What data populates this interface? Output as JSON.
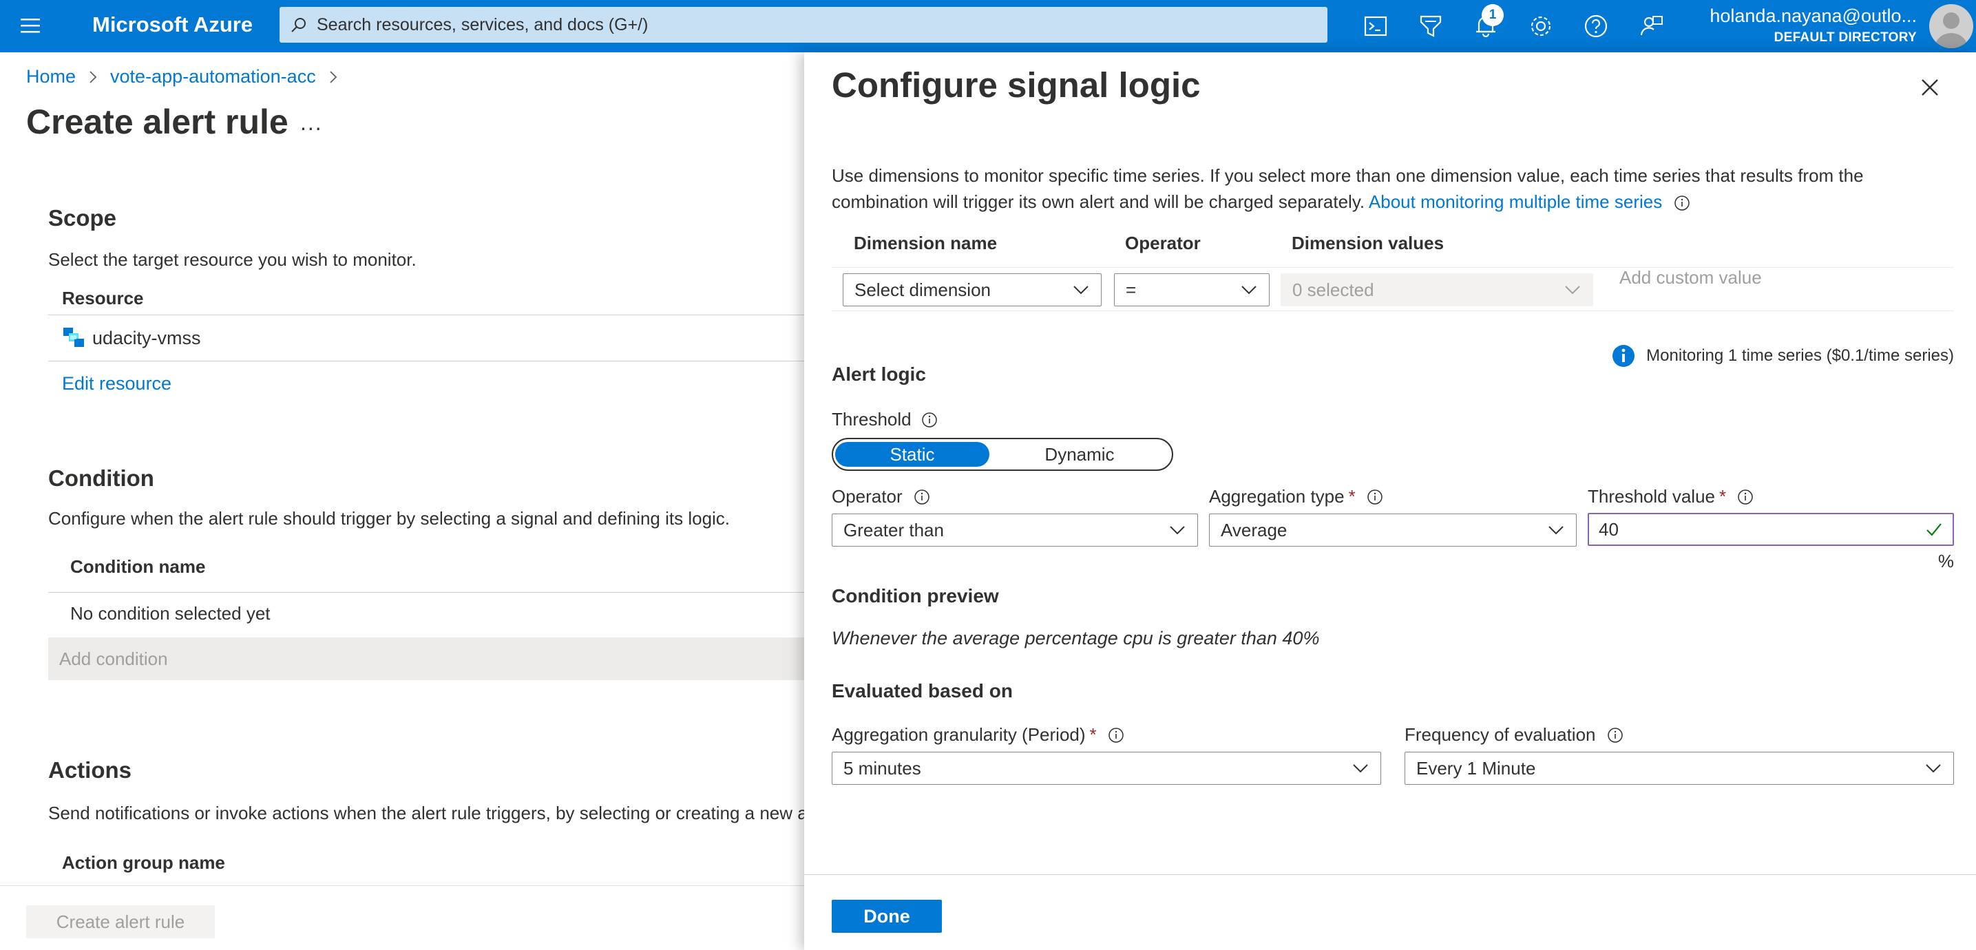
{
  "topbar": {
    "brand": "Microsoft Azure",
    "search_placeholder": "Search resources, services, and docs (G+/)",
    "notification_count": "1",
    "user_email": "holanda.nayana@outlo...",
    "user_directory": "DEFAULT DIRECTORY",
    "icons": [
      "cloud-shell-icon",
      "directory-filter-icon",
      "notifications-icon",
      "settings-icon",
      "help-icon",
      "feedback-icon"
    ]
  },
  "left": {
    "breadcrumb": [
      "Home",
      "vote-app-automation-acc"
    ],
    "title": "Create alert rule",
    "more": "...",
    "scope": {
      "heading": "Scope",
      "desc": "Select the target resource you wish to monitor.",
      "column": "Resource",
      "resource": "udacity-vmss",
      "edit_link": "Edit resource"
    },
    "condition": {
      "heading": "Condition",
      "desc": "Configure when the alert rule should trigger by selecting a signal and defining its logic.",
      "column": "Condition name",
      "empty": "No condition selected yet",
      "add_button": "Add condition"
    },
    "actions": {
      "heading": "Actions",
      "desc": "Send notifications or invoke actions when the alert rule triggers, by selecting or creating a new a",
      "column": "Action group name"
    },
    "create_button": "Create alert rule"
  },
  "panel": {
    "title": "Configure signal logic",
    "desc": "Use dimensions to monitor specific time series. If you select more than one dimension value, each time series that results from the combination will trigger its own alert and will be charged separately.",
    "desc_link": "About monitoring multiple time series",
    "dimensions": {
      "headers": [
        "Dimension name",
        "Operator",
        "Dimension values"
      ],
      "name_value": "Select dimension",
      "operator_value": "=",
      "values_value": "0 selected",
      "custom_placeholder": "Add custom value"
    },
    "monitoring_note": "Monitoring 1 time series ($0.1/time series)",
    "alert_logic": {
      "heading": "Alert logic",
      "threshold_label": "Threshold",
      "threshold_options": [
        "Static",
        "Dynamic"
      ],
      "selected_option": "Static",
      "operator_label": "Operator",
      "operator_value": "Greater than",
      "aggregation_label": "Aggregation type",
      "aggregation_value": "Average",
      "threshold_value_label": "Threshold value",
      "threshold_value": "40",
      "unit": "%"
    },
    "preview": {
      "heading": "Condition preview",
      "text": "Whenever the average percentage cpu is greater than 40%"
    },
    "evaluation": {
      "heading": "Evaluated based on",
      "granularity_label": "Aggregation granularity (Period)",
      "granularity_value": "5 minutes",
      "frequency_label": "Frequency of evaluation",
      "frequency_value": "Every 1 Minute"
    },
    "done_button": "Done"
  },
  "colors": {
    "accent": "#0078d4",
    "topbar": "#0078d4",
    "required": "#a4262c",
    "valid_check": "#107c10",
    "input_focus": "#8764b8"
  }
}
